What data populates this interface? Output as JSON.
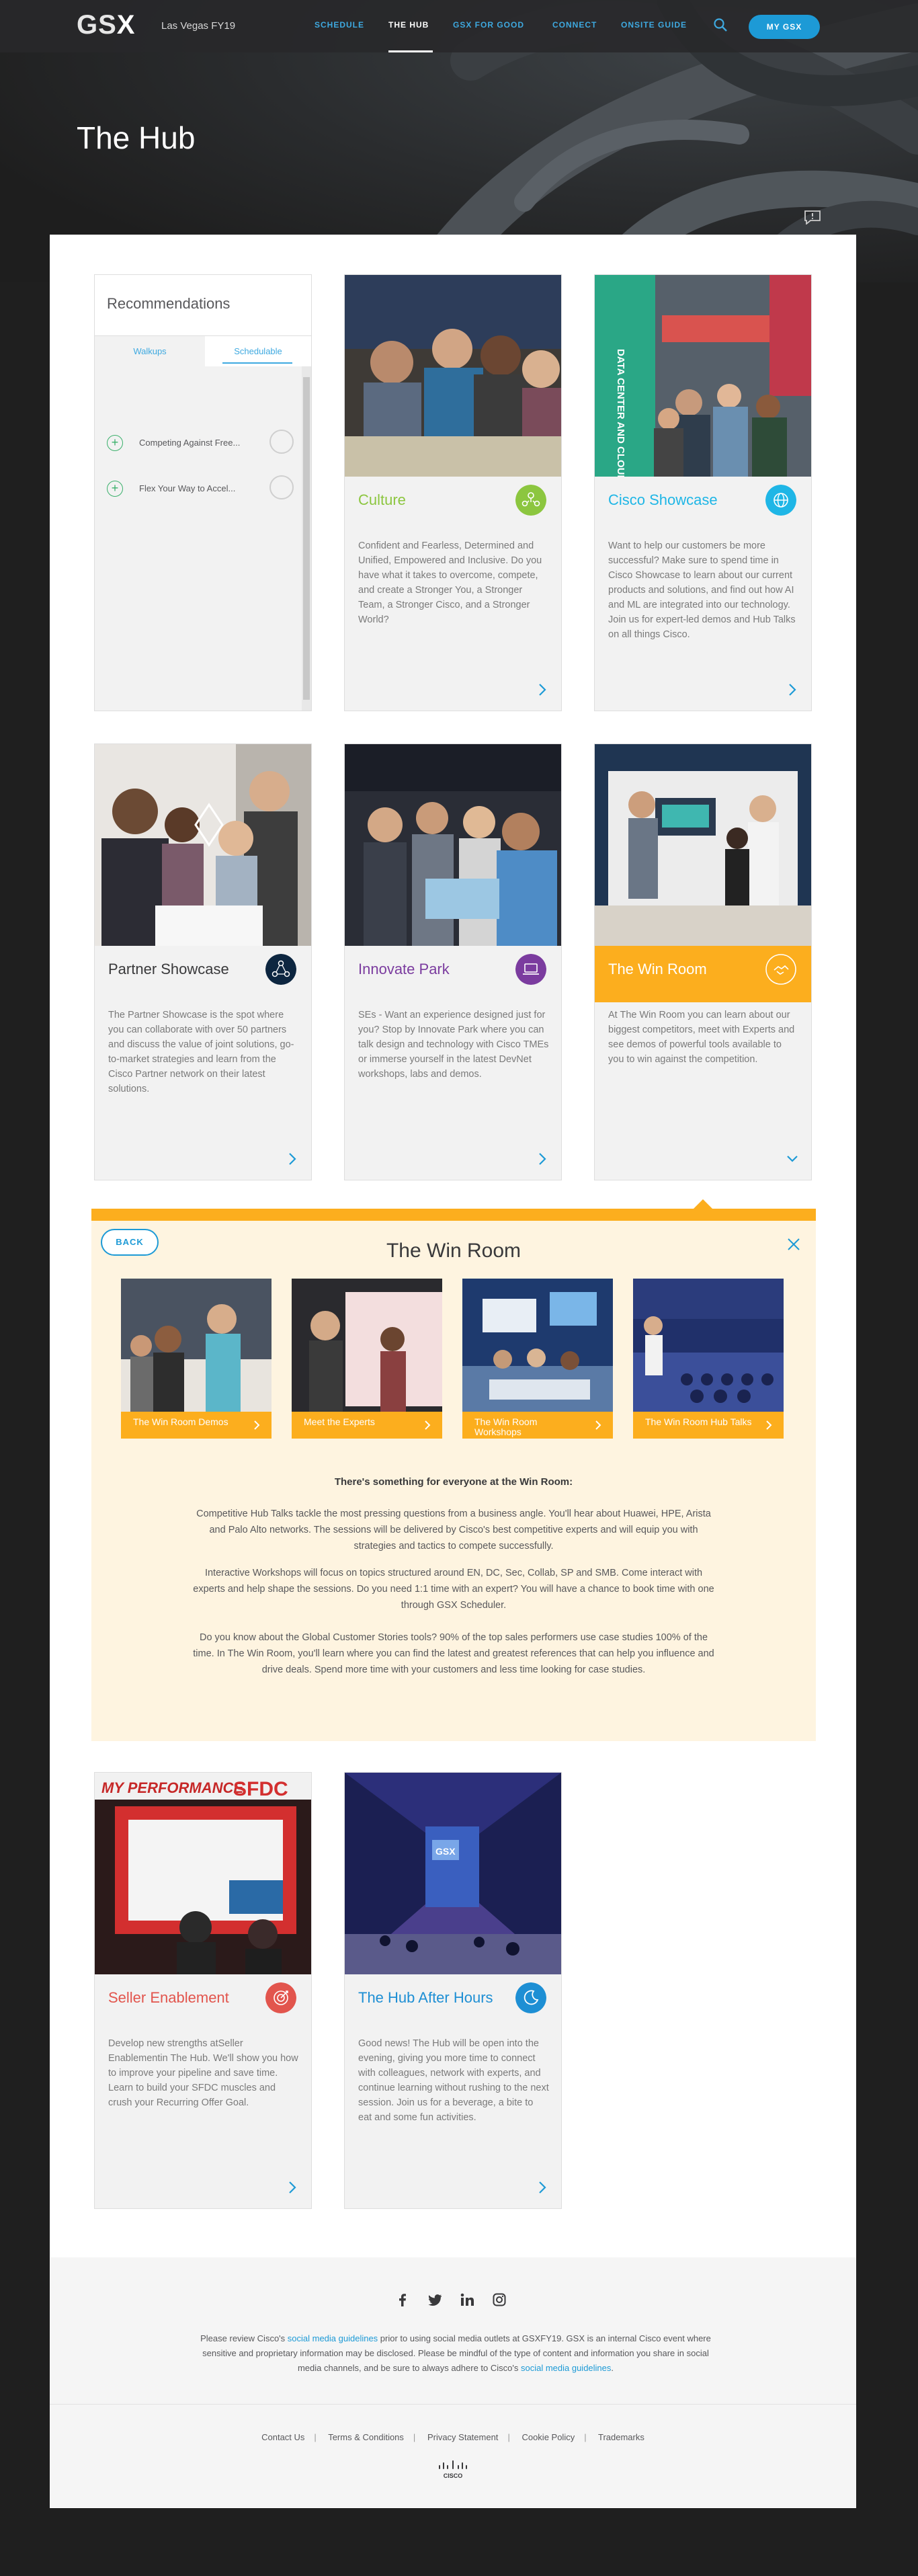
{
  "header": {
    "logo_text": "GS",
    "logo_x": "X",
    "event": "Las Vegas FY19",
    "nav": [
      "SCHEDULE",
      "THE HUB",
      "GSX FOR GOOD",
      "CONNECT",
      "ONSITE GUIDE"
    ],
    "active_nav": "THE HUB",
    "my_gsx": "MY GSX"
  },
  "hero": {
    "title": "The Hub"
  },
  "recommendations": {
    "title": "Recommendations",
    "tabs": [
      "Walkups",
      "Schedulable"
    ],
    "active_tab": "Schedulable",
    "items": [
      "Competing Against Free...",
      "Flex Your Way to Accel..."
    ]
  },
  "cards": [
    {
      "title": "Culture",
      "color": "#8cc63f",
      "icon": "people-network-icon",
      "body": "Confident and Fearless, Determined and Unified, Empowered and Inclusive. Do you have what it takes to overcome, compete, and create a Stronger You, a Stronger Team, a Stronger Cisco, and a Stronger World?"
    },
    {
      "title": "Cisco Showcase",
      "color": "#1fb6e6",
      "icon": "globe-icon",
      "body": "Want to help our customers be more successful? Make sure to spend time in Cisco Showcase to learn about our current products and solutions, and find out how AI and ML are integrated into our technology. Join us for expert-led demos and Hub Talks on all things Cisco."
    },
    {
      "title": "Partner Showcase",
      "color": "#0d2640",
      "icon": "partners-icon",
      "body": "The Partner Showcase is the spot where you can collaborate with over 50 partners and discuss the value of joint solutions, go-to-market strategies and learn from the Cisco Partner network on their latest solutions."
    },
    {
      "title": "Innovate Park",
      "color": "#7b3c9f",
      "icon": "laptop-icon",
      "body": "SEs - Want an experience designed just for you? Stop by Innovate Park where you can talk design and technology with Cisco TMEs or immerse yourself in the latest DevNet workshops, labs and demos."
    },
    {
      "title": "The Win Room",
      "color": "#fcae1e",
      "icon": "handshake-icon",
      "body": "At The Win Room you can learn about our biggest competitors, meet with Experts and see demos of powerful tools available to you to win against the competition."
    },
    {
      "title": "Seller Enablement",
      "color": "#e2554d",
      "icon": "target-icon",
      "body": "Develop new strengths atSeller Enablementin The Hub. We'll show you how to improve your pipeline and save time. Learn to build your SFDC muscles and crush your Recurring Offer Goal."
    },
    {
      "title": "The Hub After Hours",
      "color": "#1e8fd4",
      "icon": "moon-icon",
      "body": "Good news! The Hub will be open into the evening, giving you more time to connect with colleagues, network with experts, and continue learning without rushing to the next session. Join us for a beverage, a bite to eat and some fun activities."
    }
  ],
  "win_room": {
    "back": "BACK",
    "title": "The Win Room",
    "sub_items": [
      "The Win Room Demos",
      "Meet the Experts",
      "The Win Room Workshops",
      "The Win Room Hub Talks"
    ],
    "heading": "There's something for everyone at the Win Room:",
    "paragraphs": [
      "Competitive Hub Talks tackle the most pressing questions from a business angle. You'll hear about Huawei, HPE, Arista and Palo Alto networks. The sessions will be delivered by Cisco's best competitive experts and will equip you with strategies and tactics to compete successfully.",
      "Interactive Workshops will focus on topics structured around EN, DC, Sec, Collab, SP and SMB. Come interact with experts and help shape the sessions. Do you need 1:1 time with an expert? You will have a chance to book time with one through GSX Scheduler.",
      "Do you know about the Global Customer Stories tools? 90% of the top sales performers use case studies 100% of the time. In The Win Room, you'll learn where you can find the latest and greatest references that can help you influence and drive deals. Spend more time with your customers and less time looking for case studies."
    ]
  },
  "photo_signs": {
    "culture_banner": "DATA CENTER AND CLOUD",
    "sfdc": "SFDC",
    "sfdc_sub": "MY PERFORMANCE",
    "gsx_sign": "GSX"
  },
  "footer": {
    "note_1": "Please review Cisco's ",
    "link_1": "social media guidelines",
    "note_2": " prior to using social media outlets at GSXFY19. GSX is an internal Cisco event where sensitive and proprietary information may be disclosed. Please be mindful of the type of content and information you share in social media channels, and be sure to always adhere to Cisco's ",
    "link_2": "social media guidelines",
    "note_3": ".",
    "links": [
      "Contact Us",
      "Terms & Conditions",
      "Privacy Statement",
      "Cookie Policy",
      "Trademarks"
    ],
    "cisco": "CISCO"
  }
}
